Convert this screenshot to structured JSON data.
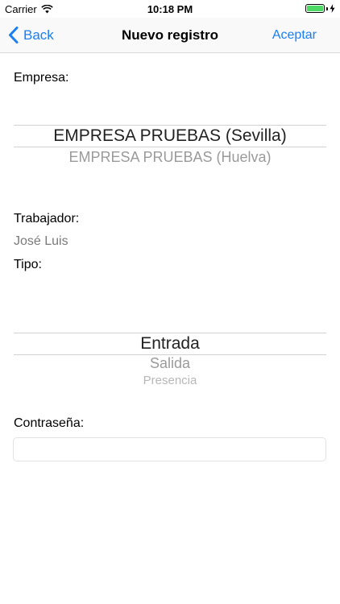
{
  "status_bar": {
    "carrier": "Carrier",
    "time": "10:18 PM",
    "battery_color": "#4cd964",
    "icons": [
      "wifi-icon",
      "battery-icon",
      "charging-icon"
    ]
  },
  "nav": {
    "back_label": "Back",
    "title": "Nuevo registro",
    "accept_label": "Aceptar",
    "tint_color": "#1a7ef4"
  },
  "form": {
    "empresa_label": "Empresa:",
    "empresa_options": [
      "EMPRESA PRUEBAS (Sevilla)",
      "EMPRESA PRUEBAS (Huelva)"
    ],
    "empresa_selected": "EMPRESA PRUEBAS (Sevilla)",
    "trabajador_label": "Trabajador:",
    "trabajador_value": "José Luis",
    "tipo_label": "Tipo:",
    "tipo_options": [
      "Entrada",
      "Salida",
      "Presencia"
    ],
    "tipo_selected": "Entrada",
    "password_label": "Contraseña:",
    "password_value": "",
    "password_placeholder": ""
  }
}
